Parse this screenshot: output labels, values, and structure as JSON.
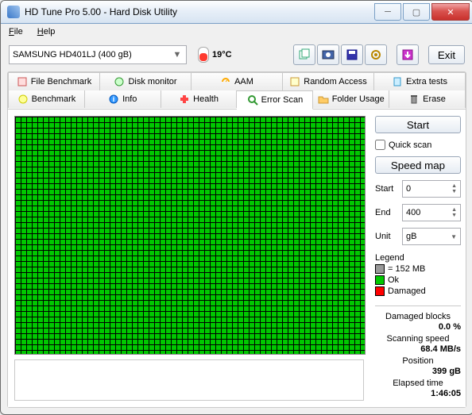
{
  "window": {
    "title": "HD Tune Pro 5.00 - Hard Disk Utility"
  },
  "menu": {
    "file": "File",
    "help": "Help"
  },
  "toolbar": {
    "drive": "SAMSUNG HD401LJ (400 gB)",
    "temp": "19°C",
    "exit": "Exit"
  },
  "tabs": {
    "r1": {
      "file_bench": "File Benchmark",
      "disk_mon": "Disk monitor",
      "aam": "AAM",
      "random": "Random Access",
      "extra": "Extra tests"
    },
    "r2": {
      "bench": "Benchmark",
      "info": "Info",
      "health": "Health",
      "error_scan": "Error Scan",
      "folder": "Folder Usage",
      "erase": "Erase"
    }
  },
  "controls": {
    "start": "Start",
    "quick": "Quick scan",
    "speed_map": "Speed map",
    "start_lbl": "Start",
    "start_val": "0",
    "end_lbl": "End",
    "end_val": "400",
    "unit_lbl": "Unit",
    "unit_val": "gB"
  },
  "legend": {
    "title": "Legend",
    "size": "= 152 MB",
    "ok": "Ok",
    "damaged": "Damaged"
  },
  "stats": {
    "damaged_lbl": "Damaged blocks",
    "damaged_val": "0.0 %",
    "speed_lbl": "Scanning speed",
    "speed_val": "68.4 MB/s",
    "pos_lbl": "Position",
    "pos_val": "399 gB",
    "elapsed_lbl": "Elapsed time",
    "elapsed_val": "1:46:05"
  }
}
